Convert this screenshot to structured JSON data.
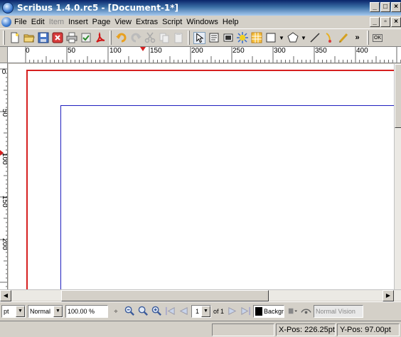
{
  "window": {
    "title": "Scribus 1.4.0.rc5 - [Document-1*]",
    "controls": [
      "_",
      "□",
      "×"
    ]
  },
  "menubar": {
    "items": [
      {
        "label": "File",
        "enabled": true
      },
      {
        "label": "Edit",
        "enabled": true
      },
      {
        "label": "Item",
        "enabled": false
      },
      {
        "label": "Insert",
        "enabled": true
      },
      {
        "label": "Page",
        "enabled": true
      },
      {
        "label": "View",
        "enabled": true
      },
      {
        "label": "Extras",
        "enabled": true
      },
      {
        "label": "Script",
        "enabled": true
      },
      {
        "label": "Windows",
        "enabled": true
      },
      {
        "label": "Help",
        "enabled": true
      }
    ],
    "doc_controls": [
      "_",
      "▫",
      "×"
    ]
  },
  "toolbar": {
    "icons": [
      "new-document-icon",
      "open-icon",
      "save-icon",
      "close-document-icon",
      "print-icon",
      "preflight-icon",
      "pdf-export-icon",
      "undo-icon",
      "redo-icon",
      "cut-icon",
      "copy-icon",
      "paste-icon",
      "select-icon",
      "text-frame-icon",
      "image-frame-icon",
      "render-frame-icon",
      "table-icon",
      "shape-icon",
      "polygon-icon",
      "line-icon",
      "bezier-icon",
      "freehand-icon"
    ],
    "overflow": "»"
  },
  "ruler_h": {
    "labels": [
      "0",
      "50",
      "100",
      "150",
      "200",
      "250",
      "300",
      "350",
      "400"
    ]
  },
  "ruler_v": {
    "labels": [
      "0",
      "50",
      "100",
      "150",
      "200"
    ]
  },
  "bottombar": {
    "unit": "pt",
    "mode": "Normal",
    "mode2": "Normal",
    "zoom": "100.00 %",
    "page_current": "1",
    "page_total": "of 1",
    "layer": "Backgr",
    "vision": "Normal Vision"
  },
  "statusbar": {
    "xpos_label": "X-Pos:",
    "xpos_value": "226.25pt",
    "ypos_label": "Y-Pos:",
    "ypos_value": "97.00pt"
  },
  "colors": {
    "title_gradient_start": "#0a246a",
    "page_border": "#d62020",
    "margin_guide": "#1f1fbf",
    "chrome": "#d4d0c8"
  }
}
